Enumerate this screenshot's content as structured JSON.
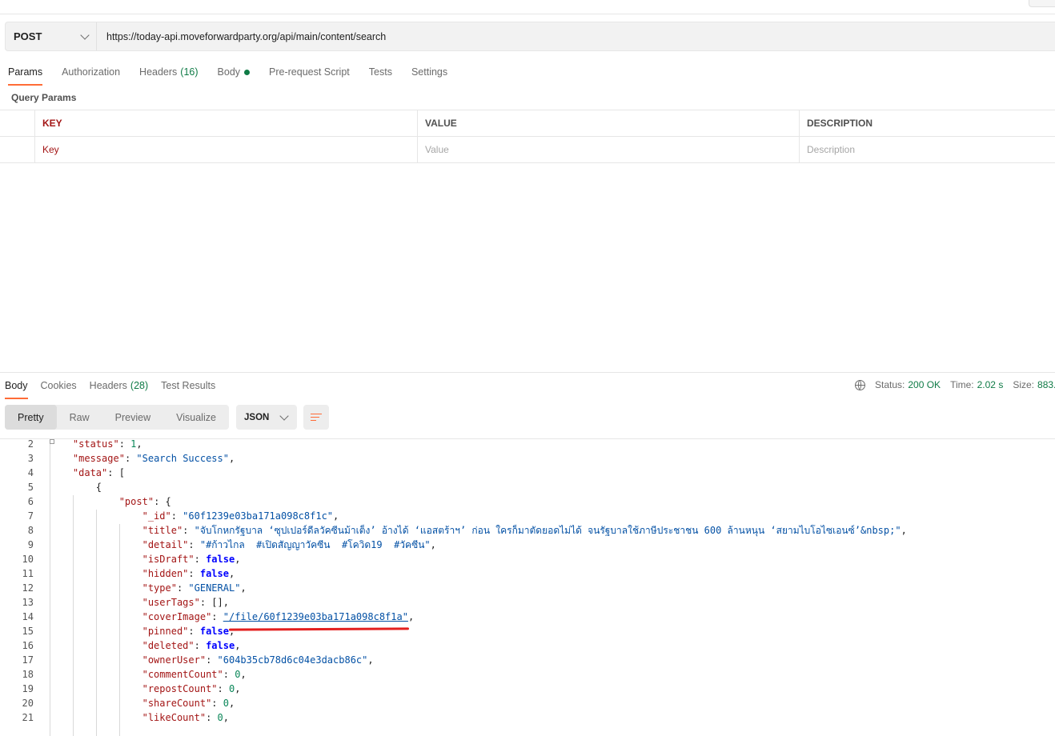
{
  "request": {
    "method": "POST",
    "url": "https://today-api.moveforwardparty.org/api/main/content/search",
    "tabs": [
      {
        "label": "Params",
        "count": ""
      },
      {
        "label": "Authorization",
        "count": ""
      },
      {
        "label": "Headers",
        "count": "(16)"
      },
      {
        "label": "Body",
        "count": ""
      },
      {
        "label": "Pre-request Script",
        "count": ""
      },
      {
        "label": "Tests",
        "count": ""
      },
      {
        "label": "Settings",
        "count": ""
      }
    ],
    "query_params_title": "Query Params",
    "table": {
      "headers": [
        "KEY",
        "VALUE",
        "DESCRIPTION"
      ],
      "placeholders": [
        "Key",
        "Value",
        "Description"
      ]
    }
  },
  "response": {
    "tabs": [
      {
        "label": "Body",
        "count": ""
      },
      {
        "label": "Cookies",
        "count": ""
      },
      {
        "label": "Headers",
        "count": "(28)"
      },
      {
        "label": "Test Results",
        "count": ""
      }
    ],
    "status_label": "Status:",
    "status_value": "200 OK",
    "time_label": "Time:",
    "time_value": "2.02 s",
    "size_label": "Size:",
    "size_value": "883.",
    "view_modes": [
      "Pretty",
      "Raw",
      "Preview",
      "Visualize"
    ],
    "format": "JSON",
    "lines": [
      {
        "n": "2",
        "ind": 1,
        "k": "status",
        "t": "num",
        "v": "1",
        "e": ","
      },
      {
        "n": "3",
        "ind": 1,
        "k": "message",
        "t": "str",
        "v": "\"Search Success\"",
        "e": ","
      },
      {
        "n": "4",
        "ind": 1,
        "k": "data",
        "t": "punc",
        "v": "[",
        "e": ""
      },
      {
        "n": "5",
        "ind": 2,
        "k": "",
        "t": "punc",
        "v": "{",
        "e": ""
      },
      {
        "n": "6",
        "ind": 3,
        "k": "post",
        "t": "punc",
        "v": "{",
        "e": ""
      },
      {
        "n": "7",
        "ind": 4,
        "k": "_id",
        "t": "str",
        "v": "\"60f1239e03ba171a098c8f1c\"",
        "e": ","
      },
      {
        "n": "8",
        "ind": 4,
        "k": "title",
        "t": "str",
        "v": "\"จับโกหกรัฐบาล ‘ซุปเปอร์ดีลวัคซีนม้าเต็ง’ อ้างได้ ‘แอสตร้าฯ’ ก่อน ใครก็มาตัดยอดไม่ได้ จนรัฐบาลใช้ภาษีประชาชน 600 ล้านหนุน ‘สยามไบโอไซเอนซ์’&nbsp;\"",
        "e": ","
      },
      {
        "n": "9",
        "ind": 4,
        "k": "detail",
        "t": "str",
        "v": "\"#ก้าวไกล  #เปิดสัญญาวัคซีน  #โควิด19  #วัคซีน\"",
        "e": ","
      },
      {
        "n": "10",
        "ind": 4,
        "k": "isDraft",
        "t": "bool",
        "v": "false",
        "e": ","
      },
      {
        "n": "11",
        "ind": 4,
        "k": "hidden",
        "t": "bool",
        "v": "false",
        "e": ","
      },
      {
        "n": "12",
        "ind": 4,
        "k": "type",
        "t": "str",
        "v": "\"GENERAL\"",
        "e": ","
      },
      {
        "n": "13",
        "ind": 4,
        "k": "userTags",
        "t": "punc",
        "v": "[]",
        "e": ","
      },
      {
        "n": "14",
        "ind": 4,
        "k": "coverImage",
        "t": "link",
        "v": "\"/file/60f1239e03ba171a098c8f1a\"",
        "e": ","
      },
      {
        "n": "15",
        "ind": 4,
        "k": "pinned",
        "t": "bool",
        "v": "false",
        "e": ","
      },
      {
        "n": "16",
        "ind": 4,
        "k": "deleted",
        "t": "bool",
        "v": "false",
        "e": ","
      },
      {
        "n": "17",
        "ind": 4,
        "k": "ownerUser",
        "t": "str",
        "v": "\"604b35cb78d6c04e3dacb86c\"",
        "e": ","
      },
      {
        "n": "18",
        "ind": 4,
        "k": "commentCount",
        "t": "num",
        "v": "0",
        "e": ","
      },
      {
        "n": "19",
        "ind": 4,
        "k": "repostCount",
        "t": "num",
        "v": "0",
        "e": ","
      },
      {
        "n": "20",
        "ind": 4,
        "k": "shareCount",
        "t": "num",
        "v": "0",
        "e": ","
      },
      {
        "n": "21",
        "ind": 4,
        "k": "likeCount",
        "t": "num",
        "v": "0",
        "e": ","
      }
    ]
  },
  "colors": {
    "accent": "#ff6c37",
    "success": "#0f7b46",
    "highlight": "#e3201f"
  }
}
